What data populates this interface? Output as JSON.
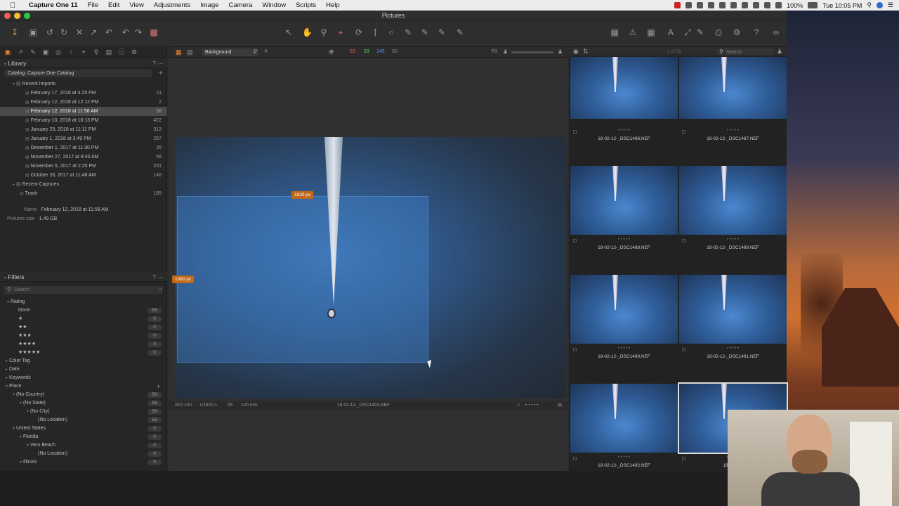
{
  "menubar": {
    "app_name": "Capture One 11",
    "items": [
      "File",
      "Edit",
      "View",
      "Adjustments",
      "Image",
      "Camera",
      "Window",
      "Scripts",
      "Help"
    ],
    "battery": "100%",
    "clock": "Tue 10:05 PM"
  },
  "window": {
    "title": "Pictures"
  },
  "library": {
    "header": "Library",
    "catalog": "Catalog: Capture One Catalog",
    "recent_imports_label": "Recent Imports",
    "imports": [
      {
        "label": "February 17, 2018 at 4:25 PM",
        "count": "11"
      },
      {
        "label": "February 12, 2018 at 12:12 PM",
        "count": "2"
      },
      {
        "label": "February 12, 2018 at 11:58 AM",
        "count": "58",
        "selected": true
      },
      {
        "label": "February 10, 2018 at 10:13 PM",
        "count": "422"
      },
      {
        "label": "January 23, 2018 at 11:11 PM",
        "count": "313"
      },
      {
        "label": "January 1, 2018 at 3:49 PM",
        "count": "257"
      },
      {
        "label": "December 1, 2017 at 11:30 PM",
        "count": "35"
      },
      {
        "label": "November 27, 2017 at 8:40 AM",
        "count": "58"
      },
      {
        "label": "November 5, 2017 at 2:25 PM",
        "count": "201"
      },
      {
        "label": "October 26, 2017 at 11:48 AM",
        "count": "146"
      }
    ],
    "recent_captures_label": "Recent Captures",
    "trash_label": "Trash",
    "trash_count": "185",
    "name_label": "Name",
    "name_value": "February 12, 2018 at 11:58 AM",
    "size_label": "Pictures size",
    "size_value": "1.49 GB"
  },
  "filters": {
    "header": "Filters",
    "search_placeholder": "Search",
    "rating_label": "Rating",
    "ratings": [
      {
        "label": "None",
        "count": "58"
      },
      {
        "label": "★",
        "count": "0"
      },
      {
        "label": "★★",
        "count": "0"
      },
      {
        "label": "★★★",
        "count": "0"
      },
      {
        "label": "★★★★",
        "count": "0"
      },
      {
        "label": "★★★★★",
        "count": "0"
      }
    ],
    "color_tag": "Color Tag",
    "date": "Date",
    "keywords": "Keywords",
    "place": "Place",
    "places": [
      {
        "label": "(No Country)",
        "count": "58",
        "indent": 1
      },
      {
        "label": "(No State)",
        "count": "58",
        "indent": 2
      },
      {
        "label": "(No City)",
        "count": "58",
        "indent": 3
      },
      {
        "label": "(No Location)",
        "count": "58",
        "indent": 4
      },
      {
        "label": "United States",
        "count": "0",
        "indent": 1
      },
      {
        "label": "Florida",
        "count": "0",
        "indent": 2
      },
      {
        "label": "Vero Beach",
        "count": "0",
        "indent": 3
      },
      {
        "label": "(No Location)",
        "count": "0",
        "indent": 4
      },
      {
        "label": "Illinois",
        "count": "0",
        "indent": 2
      }
    ]
  },
  "viewer": {
    "background_select": "Background",
    "histogram_values": [
      "63",
      "93",
      "145",
      "90"
    ],
    "width_label": "1620 px",
    "height_label": "1080 px",
    "iso": "ISO 100",
    "shutter": "1/1600 s",
    "aperture": "f/5",
    "focal": "120 mm",
    "filename": "18-02-12-_DSC1493.NEF"
  },
  "browser": {
    "count": "1 of 58",
    "search_placeholder": "Search",
    "thumbs": [
      "18-02-12-_DSC1486.NEF",
      "18-02-12-_DSC1487.NEF",
      "18-02-12-_DSC1488.NEF",
      "18-02-12-_DSC1489.NEF",
      "18-02-12-_DSC1490.NEF",
      "18-02-12-_DSC1491.NEF",
      "18-02-12-_DSC1492.NEF",
      "18-02-12-"
    ]
  }
}
